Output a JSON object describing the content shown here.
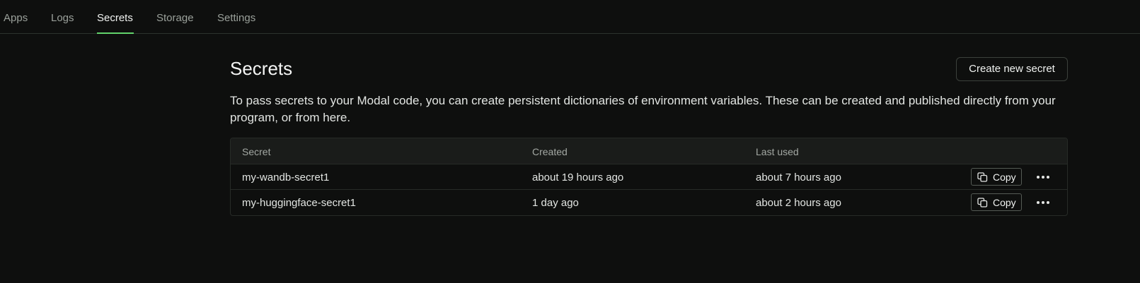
{
  "nav": {
    "tabs": [
      {
        "label": "Apps"
      },
      {
        "label": "Logs"
      },
      {
        "label": "Secrets"
      },
      {
        "label": "Storage"
      },
      {
        "label": "Settings"
      }
    ],
    "active_tab": "Secrets"
  },
  "page": {
    "title": "Secrets",
    "create_button": "Create new secret",
    "description": "To pass secrets to your Modal code, you can create persistent dictionaries of environment variables. These can be created and published directly from your program, or from here."
  },
  "table": {
    "columns": [
      "Secret",
      "Created",
      "Last used"
    ],
    "rows": [
      {
        "secret": "my-wandb-secret1",
        "created": "about 19 hours ago",
        "last_used": "about 7 hours ago",
        "copy_label": "Copy"
      },
      {
        "secret": "my-huggingface-secret1",
        "created": "1 day ago",
        "last_used": "about 2 hours ago",
        "copy_label": "Copy"
      }
    ]
  },
  "icons": {
    "copy": "copy-icon",
    "more": "more-horizontal-icon"
  },
  "colors": {
    "background": "#0e0f0e",
    "active_tab_underline": "#62d36b",
    "border": "#272b27"
  }
}
